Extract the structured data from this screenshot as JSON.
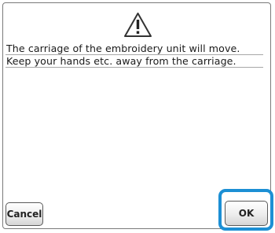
{
  "dialog": {
    "icon": "warning-triangle-icon",
    "message_lines": [
      "The carriage of the embroidery unit will move.",
      "Keep your hands etc. away from the carriage."
    ]
  },
  "buttons": {
    "cancel_label": "Cancel",
    "ok_label": "OK"
  },
  "colors": {
    "highlight": "#1c8fd4"
  }
}
